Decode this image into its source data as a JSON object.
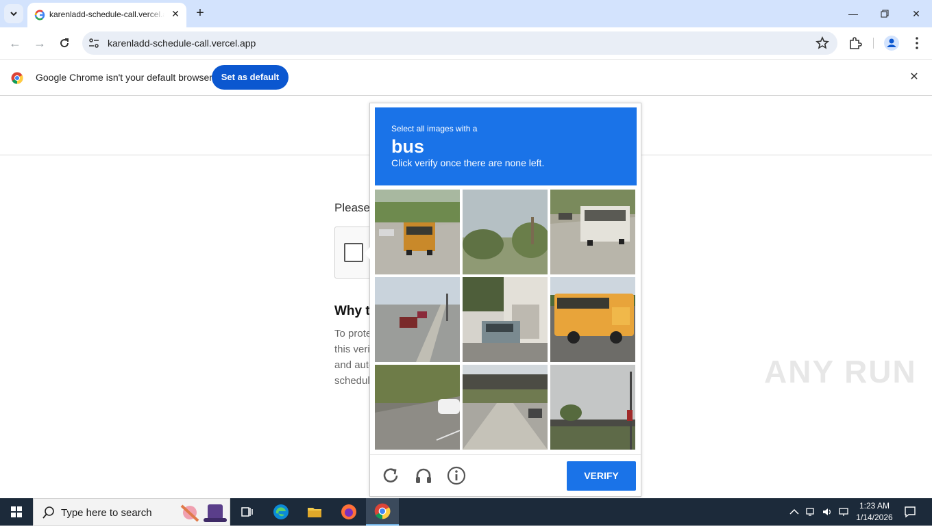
{
  "browser": {
    "tab_title": "karenladd-schedule-call.vercel.app",
    "url": "karenladd-schedule-call.vercel.app",
    "infobar_message": "Google Chrome isn't your default browser",
    "set_default_label": "Set as default"
  },
  "page": {
    "please_text": "Please",
    "why_heading": "Why t",
    "why_lines": [
      "To prote",
      "this veri",
      "and auto",
      "schedul"
    ]
  },
  "captcha": {
    "select_text": "Select all images with a",
    "object": "bus",
    "instruction": "Click verify once there are none left.",
    "verify_label": "VERIFY",
    "tiles": [
      {
        "id": 1,
        "content": "school bus on road"
      },
      {
        "id": 2,
        "content": "trees and sky"
      },
      {
        "id": 3,
        "content": "bus on street"
      },
      {
        "id": 4,
        "content": "road with cars"
      },
      {
        "id": 5,
        "content": "car by building"
      },
      {
        "id": 6,
        "content": "school bus"
      },
      {
        "id": 7,
        "content": "road with car"
      },
      {
        "id": 8,
        "content": "bridge over road"
      },
      {
        "id": 9,
        "content": "traffic light and bridge"
      }
    ]
  },
  "watermark": "ANY RUN",
  "taskbar": {
    "search_placeholder": "Type here to search",
    "time": "1:23 AM",
    "date": "1/14/2026"
  },
  "colors": {
    "accent_blue": "#1a73e8",
    "chrome_button_blue": "#0b57d0",
    "tabstrip": "#d3e3fd",
    "taskbar": "#1c2a3a"
  }
}
